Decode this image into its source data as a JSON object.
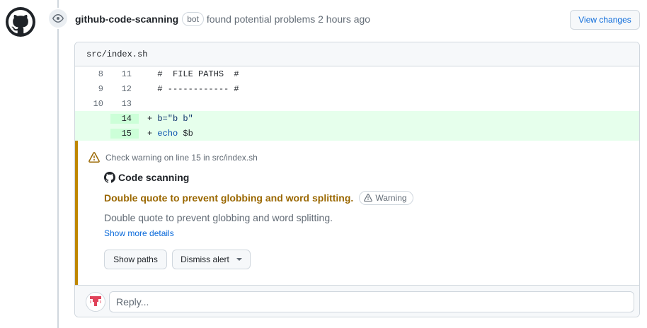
{
  "event": {
    "author": "github-code-scanning",
    "badge": "bot",
    "action": "found potential problems",
    "time": "2 hours ago",
    "view_changes_label": "View changes"
  },
  "file": {
    "path": "src/index.sh",
    "lines": [
      {
        "old": "8",
        "new": "11",
        "sign": " ",
        "text": "#  FILE PATHS  #",
        "added": false
      },
      {
        "old": "9",
        "new": "12",
        "sign": " ",
        "text": "# ------------ #",
        "added": false
      },
      {
        "old": "10",
        "new": "13",
        "sign": " ",
        "text": "",
        "added": false
      },
      {
        "old": "",
        "new": "14",
        "sign": "+",
        "text": "b=\"b b\"",
        "added": true
      },
      {
        "old": "",
        "new": "15",
        "sign": "+",
        "text": "echo $b",
        "added": true
      }
    ]
  },
  "alert": {
    "check_text": "Check warning on line 15 in src/index.sh",
    "tool_name": "Code scanning",
    "title": "Double quote to prevent globbing and word splitting.",
    "severity": "Warning",
    "description": "Double quote to prevent globbing and word splitting.",
    "show_more": "Show more details",
    "show_paths_label": "Show paths",
    "dismiss_label": "Dismiss alert"
  },
  "reply": {
    "placeholder": "Reply..."
  },
  "colors": {
    "warning_accent": "#bf8700",
    "warning_title": "#9a6700",
    "link": "#0969da",
    "added_bg": "#e6ffec",
    "added_ln_bg": "#ccffd8"
  }
}
